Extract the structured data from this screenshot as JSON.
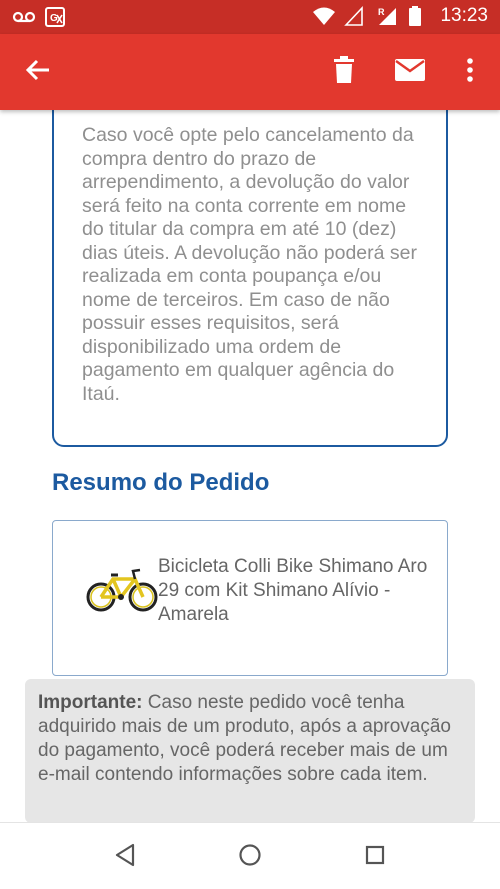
{
  "status_bar": {
    "time": "13:23",
    "icons": [
      "voicemail-icon",
      "translate-icon",
      "wifi-icon",
      "signal-empty-icon",
      "signal-roaming-icon",
      "battery-icon"
    ]
  },
  "app_bar": {
    "icons": [
      "arrow-back-icon",
      "trash-icon",
      "mail-icon",
      "more-vert-icon"
    ]
  },
  "refund_card": {
    "text": "Caso você opte pelo cancelamento da compra dentro do prazo de arrependimento, a devolução do valor será feito na conta corrente em nome do titular da compra em até 10 (dez) dias úteis. A devolução não poderá ser realizada em conta poupança e/ou nome de terceiros. Em caso de não possuir esses requisitos, será disponibilizado uma ordem de pagamento em qualquer agência do Itaú."
  },
  "order_summary": {
    "title": "Resumo do Pedido",
    "product_name": "Bicicleta Colli Bike Shimano Aro 29 com Kit Shimano Alívio - Amarela",
    "product_image": "bicycle-icon"
  },
  "notice": {
    "label": "Importante:",
    "text": " Caso neste pedido você tenha adquirido mais de um produto, após a aprovação do pagamento, você poderá receber mais de um e-mail contendo informações sobre cada item."
  },
  "nav_bar": {
    "icons": [
      "nav-back-icon",
      "nav-home-icon",
      "nav-recent-icon"
    ]
  },
  "colors": {
    "status_bar": "#c62e26",
    "app_bar": "#e2382e",
    "accent_blue": "#1c5aa0",
    "notice_bg": "#e6e6e6"
  }
}
